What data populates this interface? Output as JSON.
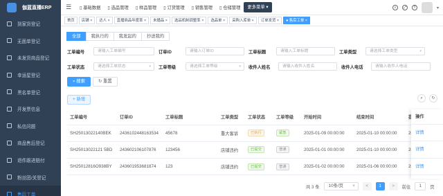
{
  "brand": "伽蓝直播ERP",
  "sidebar": {
    "items": [
      {
        "label": "到家货登记",
        "active": false
      },
      {
        "label": "无面单登记",
        "active": false
      },
      {
        "label": "未发货商品登记",
        "active": false
      },
      {
        "label": "幸运星登记",
        "active": false
      },
      {
        "label": "黑名单登记",
        "active": false
      },
      {
        "label": "开发票信息",
        "active": false
      },
      {
        "label": "私信问题",
        "active": false
      },
      {
        "label": "商品售后登记",
        "active": false
      },
      {
        "label": "退件跟进赔付",
        "active": false
      },
      {
        "label": "粉丝团/关登记",
        "active": false
      },
      {
        "label": "售后工单",
        "active": true
      }
    ]
  },
  "topnav": {
    "menu": [
      {
        "label": "基础数据",
        "icon": "▯"
      },
      {
        "label": "选品管理",
        "icon": "▯"
      },
      {
        "label": "样品管理",
        "icon": "▯"
      },
      {
        "label": "订货管理",
        "icon": "▯"
      },
      {
        "label": "销售管理",
        "icon": "▯"
      },
      {
        "label": "仓储管理",
        "icon": "▯"
      },
      {
        "label": "更多菜单",
        "icon": "▾"
      }
    ],
    "active_index": 6
  },
  "tags": [
    {
      "label": "首页",
      "closable": false,
      "active": false
    },
    {
      "label": "店铺",
      "closable": true,
      "active": false
    },
    {
      "label": "达人",
      "closable": true,
      "active": false
    },
    {
      "label": "直播商品年度率",
      "closable": true,
      "active": false
    },
    {
      "label": "未播品",
      "closable": true,
      "active": false
    },
    {
      "label": "选品机制调整率",
      "closable": true,
      "active": false
    },
    {
      "label": "选品单",
      "closable": true,
      "active": false
    },
    {
      "label": "采购入库单",
      "closable": true,
      "active": false
    },
    {
      "label": "订单发货",
      "closable": true,
      "active": false
    },
    {
      "label": "售后工单",
      "closable": true,
      "active": true
    }
  ],
  "filter_tabs": [
    {
      "label": "全部",
      "active": true
    },
    {
      "label": "我执行的",
      "active": false
    },
    {
      "label": "我发起的",
      "active": false
    },
    {
      "label": "抄送我的",
      "active": false
    }
  ],
  "form": {
    "row1": [
      {
        "label": "工单编号",
        "placeholder": "请输入工单编号",
        "select": false
      },
      {
        "label": "订单ID",
        "placeholder": "请输入订单ID",
        "select": false
      },
      {
        "label": "工单标题",
        "placeholder": "请输入工单标题",
        "select": false
      },
      {
        "label": "工单类型",
        "placeholder": "请选择工单类型",
        "select": true
      }
    ],
    "row2": [
      {
        "label": "工单状态",
        "placeholder": "请选择工单状态",
        "select": true
      },
      {
        "label": "工单等级",
        "placeholder": "请选择工单等级",
        "select": true
      },
      {
        "label": "收件人姓名",
        "placeholder": "请输入收件人姓名",
        "select": false
      },
      {
        "label": "收件人电话",
        "placeholder": "请输入收件人电话",
        "select": false
      }
    ],
    "search_label": "搜索",
    "reset_label": "重置",
    "add_label": "新增"
  },
  "table": {
    "columns": [
      "工单编号",
      "订单ID",
      "工单标题",
      "工单类型",
      "工单状态",
      "工单等级",
      "开始时间",
      "结束时间",
      "提交日",
      "操作"
    ],
    "rows": [
      {
        "no": "SH25013022140BEK",
        "order": "2436102448163534",
        "title": "45678",
        "type": "重大客诉",
        "status": "已执行",
        "status_style": "b-orange",
        "level": "紧急",
        "level_style": "b-green",
        "start": "2025-01-09 00:00:00",
        "end": "2025-01-10 00:00:00",
        "submit": "2025-",
        "op": "详情"
      },
      {
        "no": "SH25013022121 5BD",
        "order": "2436021061078​76",
        "title": "123456",
        "type": "店铺违约",
        "status": "已提交",
        "status_style": "b-green",
        "level": "普通",
        "level_style": "b-gray",
        "start": "2025-01-01 00:00:00",
        "end": "2025-01-10 00:00:00",
        "submit": "2025-",
        "op": "详情"
      },
      {
        "no": "SH25012816O938BY",
        "order": "2436019536818​74",
        "title": "123",
        "type": "店铺违约",
        "status": "已提交",
        "status_style": "b-green",
        "level": "普通",
        "level_style": "b-gray",
        "start": "2025-01-02 00:00:00",
        "end": "2025-01-06 00:00:00",
        "submit": "2025-",
        "op": "详情"
      }
    ]
  },
  "pager": {
    "total": "共 3 条",
    "page_size": "10条/页",
    "prev": "<",
    "current": "1",
    "next": ">",
    "goto_label": "前往",
    "goto_value": "1",
    "page_suffix": "页"
  },
  "colors": {
    "primary": "#409eff",
    "sidebar": "#304156"
  }
}
